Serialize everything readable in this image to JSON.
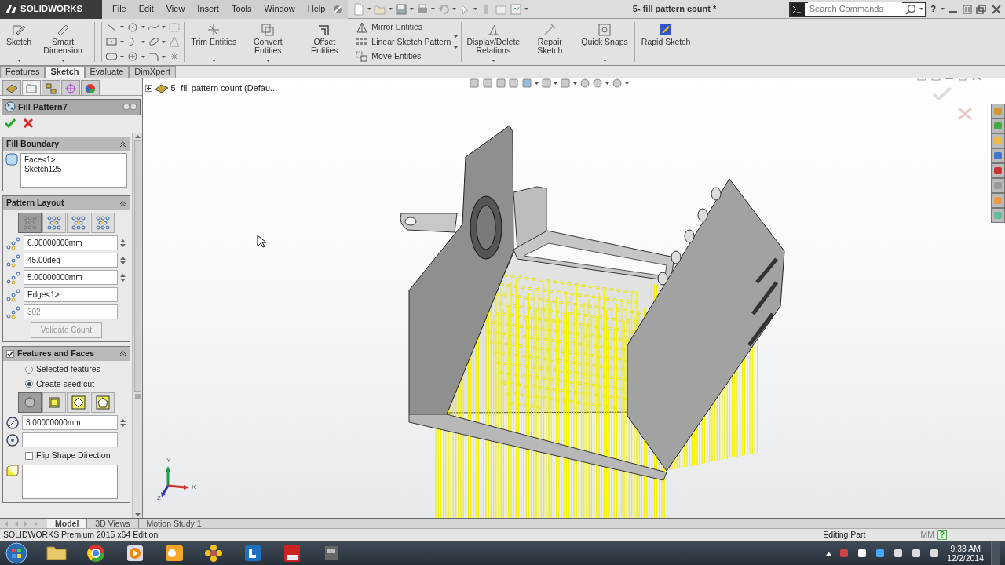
{
  "app": {
    "logo": "SOLIDWORKS",
    "menu": [
      "File",
      "Edit",
      "View",
      "Insert",
      "Tools",
      "Window",
      "Help"
    ],
    "title": "5- fill pattern count *",
    "search": {
      "placeholder": "Search Commands"
    },
    "help_glyph": "?"
  },
  "ribbon": [
    {
      "kind": "large",
      "label": "Sketch",
      "menu": true
    },
    {
      "kind": "large",
      "label": "Smart Dimension",
      "menu": true
    },
    {
      "kind": "tools"
    },
    {
      "kind": "large",
      "label": "Trim Entities",
      "menu": true
    },
    {
      "kind": "large",
      "label": "Convert Entities",
      "menu": true
    },
    {
      "kind": "large",
      "label": "Offset Entities",
      "menu": false
    },
    {
      "kind": "list",
      "items": [
        "Mirror Entities",
        "Linear Sketch Pattern",
        "Move Entities"
      ]
    },
    {
      "kind": "large",
      "label": "Display/Delete Relations",
      "menu": true
    },
    {
      "kind": "large",
      "label": "Repair Sketch",
      "menu": false
    },
    {
      "kind": "large",
      "label": "Quick Snaps",
      "menu": true
    },
    {
      "kind": "large",
      "label": "Rapid Sketch",
      "menu": false
    }
  ],
  "command_tabs": [
    {
      "label": "Features",
      "selected": false
    },
    {
      "label": "Sketch",
      "selected": true
    },
    {
      "label": "Evaluate",
      "selected": false
    },
    {
      "label": "DimXpert",
      "selected": false
    }
  ],
  "panel_tabs": [
    {
      "selected": false
    },
    {
      "selected": true
    },
    {
      "selected": false
    },
    {
      "selected": false
    },
    {
      "selected": false
    }
  ],
  "property_manager": {
    "title": "Fill Pattern7",
    "fill_boundary": {
      "title": "Fill Boundary",
      "items": [
        "Face<1>",
        "Sketch125"
      ]
    },
    "pattern_layout": {
      "title": "Pattern Layout",
      "layouts": [
        {
          "selected": true
        },
        {
          "selected": false
        },
        {
          "selected": false
        },
        {
          "selected": false
        }
      ],
      "spacing": "6.00000000mm",
      "angle": "45.00deg",
      "margin": "5.00000000mm",
      "direction": "Edge<1>",
      "count": "302",
      "validate": {
        "label": "Validate Count",
        "disabled": true
      }
    },
    "features_and_faces": {
      "title": "Features and Faces",
      "checked": true,
      "options": [
        {
          "label": "Selected features",
          "selected": false
        },
        {
          "label": "Create seed cut",
          "selected": true
        }
      ],
      "shapes": [
        {
          "selected": true
        },
        {
          "selected": false
        },
        {
          "selected": false
        },
        {
          "selected": false
        }
      ],
      "diameter": "3.00000000mm",
      "flip": {
        "label": "Flip Shape Direction",
        "checked": false
      }
    }
  },
  "tree": {
    "label": "5- fill pattern count  (Defau..."
  },
  "triad": [
    "Y",
    "X",
    "Z"
  ],
  "bottom_tabs": [
    {
      "label": "Model",
      "selected": true
    },
    {
      "label": "3D Views",
      "selected": false
    },
    {
      "label": "Motion Study 1",
      "selected": false
    }
  ],
  "status_bar": {
    "edition": "SOLIDWORKS Premium 2015 x64 Edition",
    "mode": "Editing Part",
    "units": "MM",
    "help_glyph": "?"
  },
  "taskbar": {
    "time": "9:33 AM",
    "date": "12/2/2014"
  }
}
